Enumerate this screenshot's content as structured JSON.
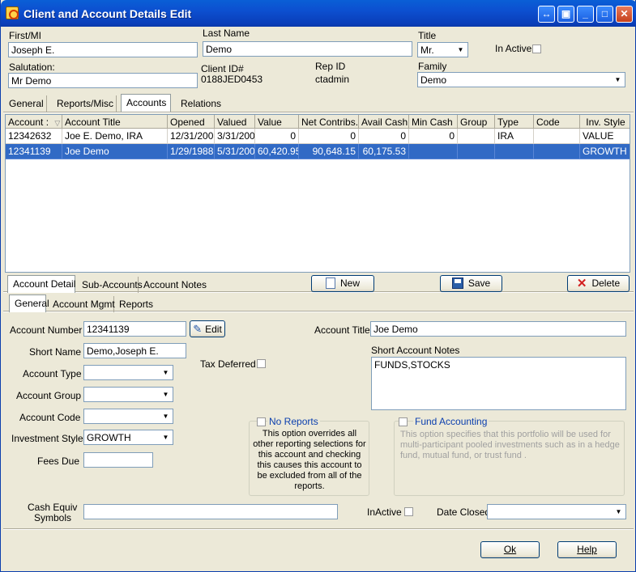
{
  "window": {
    "title": "Client and Account Details Edit"
  },
  "client": {
    "first_label": "First/MI",
    "first_value": "Joseph E.",
    "last_label": "Last Name",
    "last_value": "Demo",
    "title_label": "Title",
    "title_value": "Mr.",
    "inactive_label": "In Active",
    "salutation_label": "Salutation:",
    "salutation_value": "Mr Demo",
    "clientid_label": "Client ID#",
    "clientid_value": "0188JED0453",
    "repid_label": "Rep ID",
    "repid_value": "ctadmin",
    "family_label": "Family",
    "family_value": "Demo"
  },
  "top_tabs": [
    "General",
    "Reports/Misc",
    "Accounts",
    "Relations"
  ],
  "grid": {
    "headers": [
      "Account :",
      "Account Title",
      "Opened",
      "Valued",
      "Value",
      "Net Contribs.",
      "Avail Cash",
      "Min Cash",
      "Group",
      "Type",
      "Code",
      "Inv. Style"
    ],
    "rows": [
      [
        "12342632",
        "Joe E. Demo, IRA",
        "12/31/200",
        "3/31/200",
        "0",
        "0",
        "0",
        "0",
        "",
        "IRA",
        "",
        "VALUE"
      ],
      [
        "12341139",
        "Joe Demo",
        "1/29/1988",
        "5/31/200",
        "60,420.95",
        "90,648.15",
        "60,175.53",
        "",
        "",
        "",
        "",
        "GROWTH"
      ]
    ]
  },
  "detail_tabs": [
    "Account Detail",
    "Sub-Accounts",
    "Account Notes"
  ],
  "buttons": {
    "new": "New",
    "save": "Save",
    "delete": "Delete",
    "edit": "Edit",
    "ok": "Ok",
    "help": "Help"
  },
  "sub_tabs": [
    "General",
    "Account Mgmt",
    "Reports"
  ],
  "detail": {
    "acct_num_label": "Account Number",
    "acct_num_value": "12341139",
    "acct_title_label": "Account Title",
    "acct_title_value": "Joe Demo",
    "short_name_label": "Short Name",
    "short_name_value": "Demo,Joseph E.",
    "short_notes_label": "Short Account Notes",
    "short_notes_value": "FUNDS,STOCKS",
    "acct_type_label": "Account Type",
    "acct_type_value": "",
    "tax_deferred_label": "Tax Deferred",
    "acct_group_label": "Account Group",
    "acct_group_value": "",
    "acct_code_label": "Account Code",
    "acct_code_value": "",
    "inv_style_label": "Investment Style",
    "inv_style_value": "GROWTH",
    "fees_due_label": "Fees Due",
    "fees_due_value": "",
    "no_reports_label": "No Reports",
    "no_reports_desc": "This option overrides all other reporting selections for this account and checking this causes this account to be excluded from all of the reports.",
    "fund_acct_label": "Fund Accounting",
    "fund_acct_desc": "This option specifies that this portfolio will be used for multi-participant pooled investments such as in a hedge fund, mutual fund, or trust fund .",
    "cash_equiv_label_1": "Cash Equiv",
    "cash_equiv_label_2": "Symbols",
    "cash_equiv_value": "",
    "inactive_label": "InActive",
    "date_closed_label": "Date Closed",
    "date_closed_value": ""
  },
  "colors": {
    "title_bar": "#0a4fd0",
    "selection": "#316ac5",
    "link_blue": "#0b3fae"
  }
}
